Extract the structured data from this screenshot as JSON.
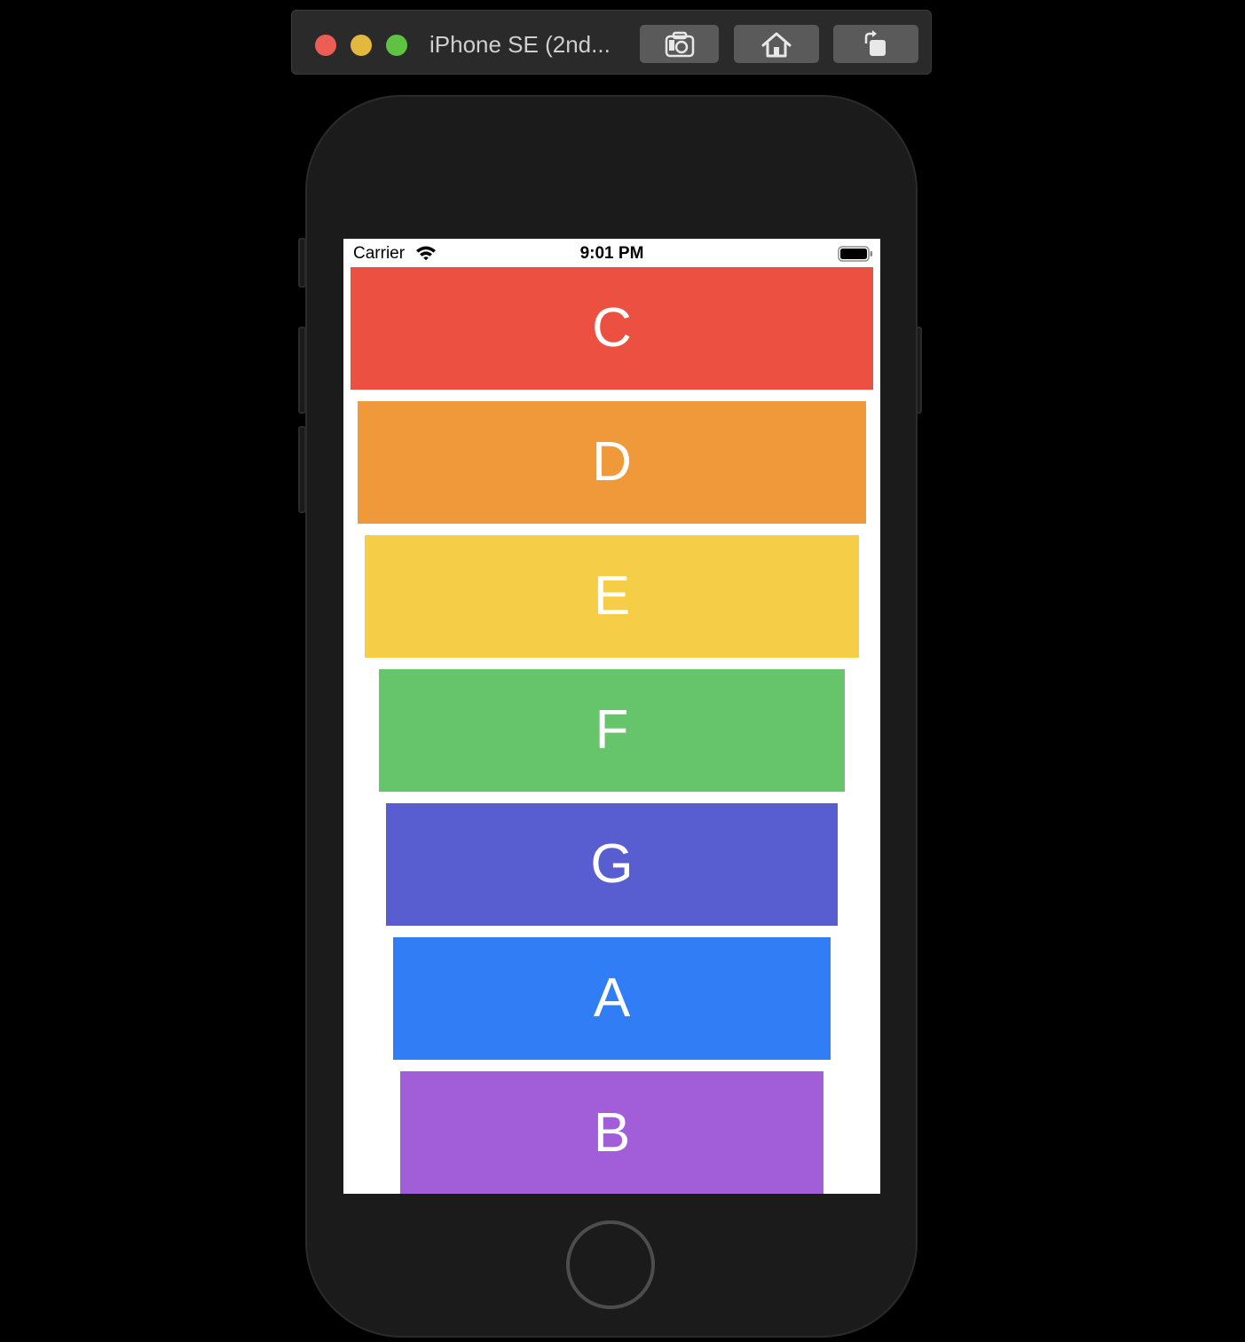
{
  "simulator": {
    "window_title": "iPhone SE (2nd...",
    "buttons": {
      "screenshot": "screenshot-icon",
      "home": "home-icon",
      "rotate": "rotate-icon"
    }
  },
  "statusbar": {
    "carrier": "Carrier",
    "time": "9:01 PM",
    "wifi": "wifi-icon",
    "battery": "battery-icon"
  },
  "list": {
    "rows": [
      {
        "label": "C",
        "color": "#eb5040"
      },
      {
        "label": "D",
        "color": "#f0993a"
      },
      {
        "label": "E",
        "color": "#f6cd46"
      },
      {
        "label": "F",
        "color": "#66c46a"
      },
      {
        "label": "G",
        "color": "#585dd0"
      },
      {
        "label": "A",
        "color": "#307df6"
      },
      {
        "label": "B",
        "color": "#a25ed8"
      }
    ]
  }
}
